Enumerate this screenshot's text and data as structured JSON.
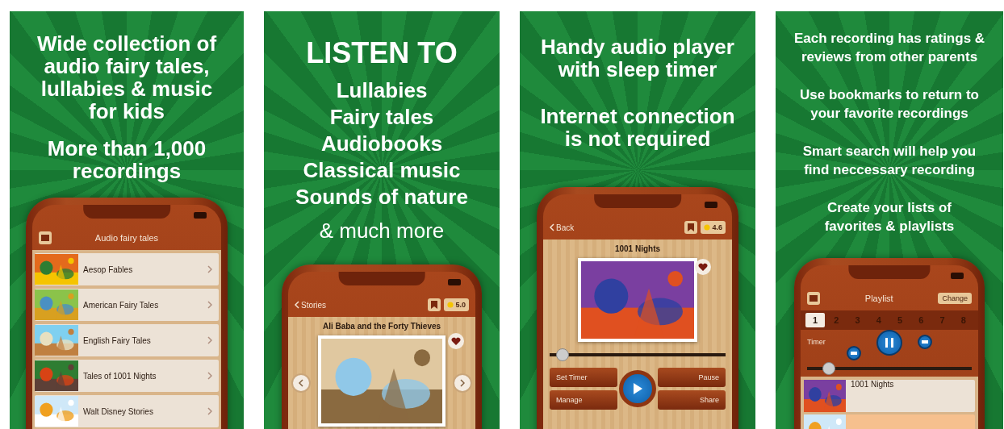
{
  "panels": [
    {
      "headline": [
        {
          "kind": "title",
          "lines": [
            "Wide collection of",
            "audio fairy tales,",
            "lullabies & music",
            "for kids"
          ]
        },
        {
          "kind": "title",
          "lines": [
            "More than 1,000",
            "recordings"
          ]
        }
      ],
      "phone": {
        "kind": "list",
        "title": "Audio fairy tales",
        "items": [
          {
            "title": "Aesop Fables"
          },
          {
            "title": "American Fairy Tales"
          },
          {
            "title": "English Fairy Tales"
          },
          {
            "title": "Tales of 1001 Nights"
          },
          {
            "title": "Walt Disney Stories"
          }
        ]
      }
    },
    {
      "headline": [
        {
          "kind": "heading",
          "lines": [
            "LISTEN TO"
          ]
        },
        {
          "kind": "title",
          "lines": [
            "Lullabies",
            "Fairy tales",
            "Audiobooks",
            "Classical music",
            "Sounds of nature"
          ]
        },
        {
          "kind": "note",
          "lines": [
            "& much more"
          ]
        }
      ],
      "phone": {
        "kind": "story",
        "back": "Stories",
        "rating": "5.0",
        "title": "Ali Baba and the Forty Thieves"
      }
    },
    {
      "headline": [
        {
          "kind": "title",
          "lines": [
            "Handy audio player",
            "with sleep timer"
          ]
        },
        {
          "kind": "title",
          "lines": [
            "Internet connection",
            "is not required"
          ]
        }
      ],
      "phone": {
        "kind": "player",
        "back": "Back",
        "rating": "4.6",
        "title": "1001 Nights",
        "level": 0.04,
        "buttons": [
          "Set Timer",
          "Pause",
          "Manage",
          "Share"
        ]
      }
    },
    {
      "headline": [
        {
          "kind": "small",
          "lines": [
            "Each recording has ratings &",
            "reviews from other parents"
          ]
        },
        {
          "kind": "small",
          "lines": [
            "Use bookmarks to return to",
            "your favorite recordings"
          ]
        },
        {
          "kind": "small",
          "lines": [
            "Smart search will help you",
            "find neccessary recording"
          ]
        },
        {
          "kind": "small",
          "lines": [
            "Create your lists of",
            "favorites & playlists"
          ]
        }
      ],
      "phone": {
        "kind": "playlist",
        "title": "Playlist",
        "action": "Change",
        "timer": "Timer",
        "level": 0.1,
        "tabs": [
          {
            "label": "1",
            "selected": true
          },
          {
            "label": "2",
            "selected": false
          },
          {
            "label": "3",
            "selected": false
          },
          {
            "label": "4",
            "selected": false
          },
          {
            "label": "5",
            "selected": false
          },
          {
            "label": "6",
            "selected": false
          },
          {
            "label": "7",
            "selected": false
          },
          {
            "label": "8",
            "selected": false
          }
        ],
        "tracks": [
          {
            "title": "1001 Nights",
            "selected": false
          },
          {
            "selected": true
          }
        ]
      }
    }
  ]
}
